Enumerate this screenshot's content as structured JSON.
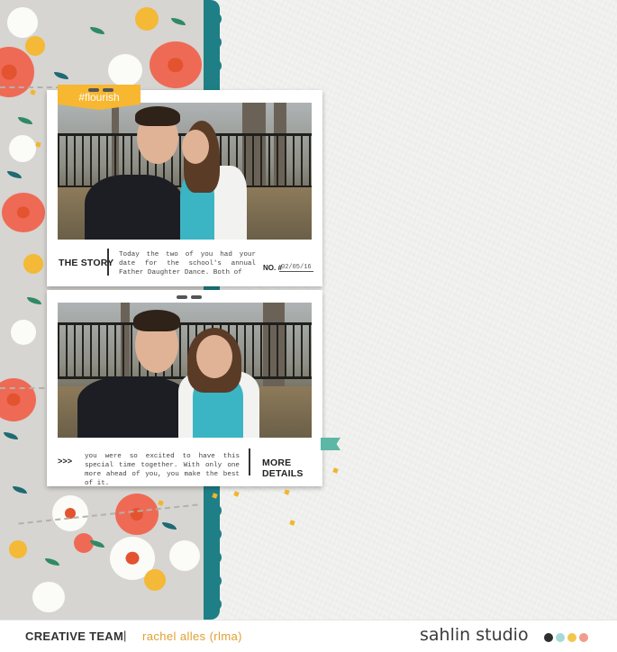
{
  "card_top": {
    "tag": "#flourish",
    "caption_title": "THE STORY",
    "caption_text": "Today the two of you had your date for the school's annual Father Daughter Dance. Both of",
    "no_label": "NO. #",
    "no_value": "02/05/16"
  },
  "card_bottom": {
    "arrows": ">>>",
    "caption_text": "you were so excited to have this special time together. With only one more ahead of you, you make the best of it.",
    "caption_title": "MORE DETAILS"
  },
  "footer": {
    "team": "CREATIVE TEAM",
    "separator": "|",
    "name": "rachel alles (rlma)",
    "brand": "sahlin studio",
    "dots": [
      "#2f2f2f",
      "#a9d8d8",
      "#f2c64d",
      "#f19c8c"
    ]
  },
  "colors": {
    "accent_yellow": "#f7b731",
    "teal": "#1e7f86",
    "coral": "#ef6a55"
  }
}
